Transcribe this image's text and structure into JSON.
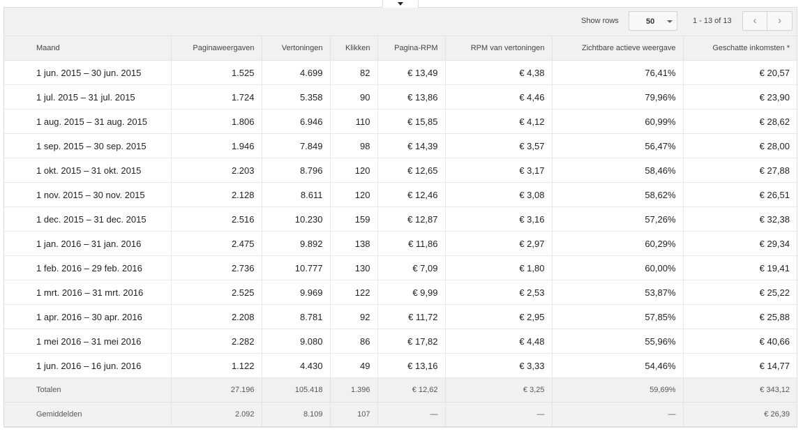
{
  "toolbar": {
    "show_rows_label": "Show rows",
    "rows_value": "50",
    "page_range": "1 - 13 of 13",
    "prev_icon": "‹",
    "next_icon": "›"
  },
  "table": {
    "headers": [
      "Maand",
      "Paginaweergaven",
      "Vertoningen",
      "Klikken",
      "Pagina-RPM",
      "RPM van vertoningen",
      "Zichtbare actieve weergave",
      "Geschatte inkomsten *"
    ],
    "rows": [
      [
        "1 jun. 2015 – 30 jun. 2015",
        "1.525",
        "4.699",
        "82",
        "€ 13,49",
        "€ 4,38",
        "76,41%",
        "€ 20,57"
      ],
      [
        "1 jul. 2015 – 31 jul. 2015",
        "1.724",
        "5.358",
        "90",
        "€ 13,86",
        "€ 4,46",
        "79,96%",
        "€ 23,90"
      ],
      [
        "1 aug. 2015 – 31 aug. 2015",
        "1.806",
        "6.946",
        "110",
        "€ 15,85",
        "€ 4,12",
        "60,99%",
        "€ 28,62"
      ],
      [
        "1 sep. 2015 – 30 sep. 2015",
        "1.946",
        "7.849",
        "98",
        "€ 14,39",
        "€ 3,57",
        "56,47%",
        "€ 28,00"
      ],
      [
        "1 okt. 2015 – 31 okt. 2015",
        "2.203",
        "8.796",
        "120",
        "€ 12,65",
        "€ 3,17",
        "58,46%",
        "€ 27,88"
      ],
      [
        "1 nov. 2015 – 30 nov. 2015",
        "2.128",
        "8.611",
        "120",
        "€ 12,46",
        "€ 3,08",
        "58,62%",
        "€ 26,51"
      ],
      [
        "1 dec. 2015 – 31 dec. 2015",
        "2.516",
        "10.230",
        "159",
        "€ 12,87",
        "€ 3,16",
        "57,26%",
        "€ 32,38"
      ],
      [
        "1 jan. 2016 – 31 jan. 2016",
        "2.475",
        "9.892",
        "138",
        "€ 11,86",
        "€ 2,97",
        "60,29%",
        "€ 29,34"
      ],
      [
        "1 feb. 2016 – 29 feb. 2016",
        "2.736",
        "10.777",
        "130",
        "€ 7,09",
        "€ 1,80",
        "60,00%",
        "€ 19,41"
      ],
      [
        "1 mrt. 2016 – 31 mrt. 2016",
        "2.525",
        "9.969",
        "122",
        "€ 9,99",
        "€ 2,53",
        "53,87%",
        "€ 25,22"
      ],
      [
        "1 apr. 2016 – 30 apr. 2016",
        "2.208",
        "8.781",
        "92",
        "€ 11,72",
        "€ 2,95",
        "57,85%",
        "€ 25,88"
      ],
      [
        "1 mei 2016 – 31 mei 2016",
        "2.282",
        "9.080",
        "86",
        "€ 17,82",
        "€ 4,48",
        "55,96%",
        "€ 40,66"
      ],
      [
        "1 jun. 2016 – 16 jun. 2016",
        "1.122",
        "4.430",
        "49",
        "€ 13,16",
        "€ 3,33",
        "54,46%",
        "€ 14,77"
      ]
    ],
    "totals": [
      "Totalen",
      "27.196",
      "105.418",
      "1.396",
      "€ 12,62",
      "€ 3,25",
      "59,69%",
      "€ 343,12"
    ],
    "averages": [
      "Gemiddelden",
      "2.092",
      "8.109",
      "107",
      "—",
      "—",
      "—",
      "€ 26,39"
    ]
  }
}
